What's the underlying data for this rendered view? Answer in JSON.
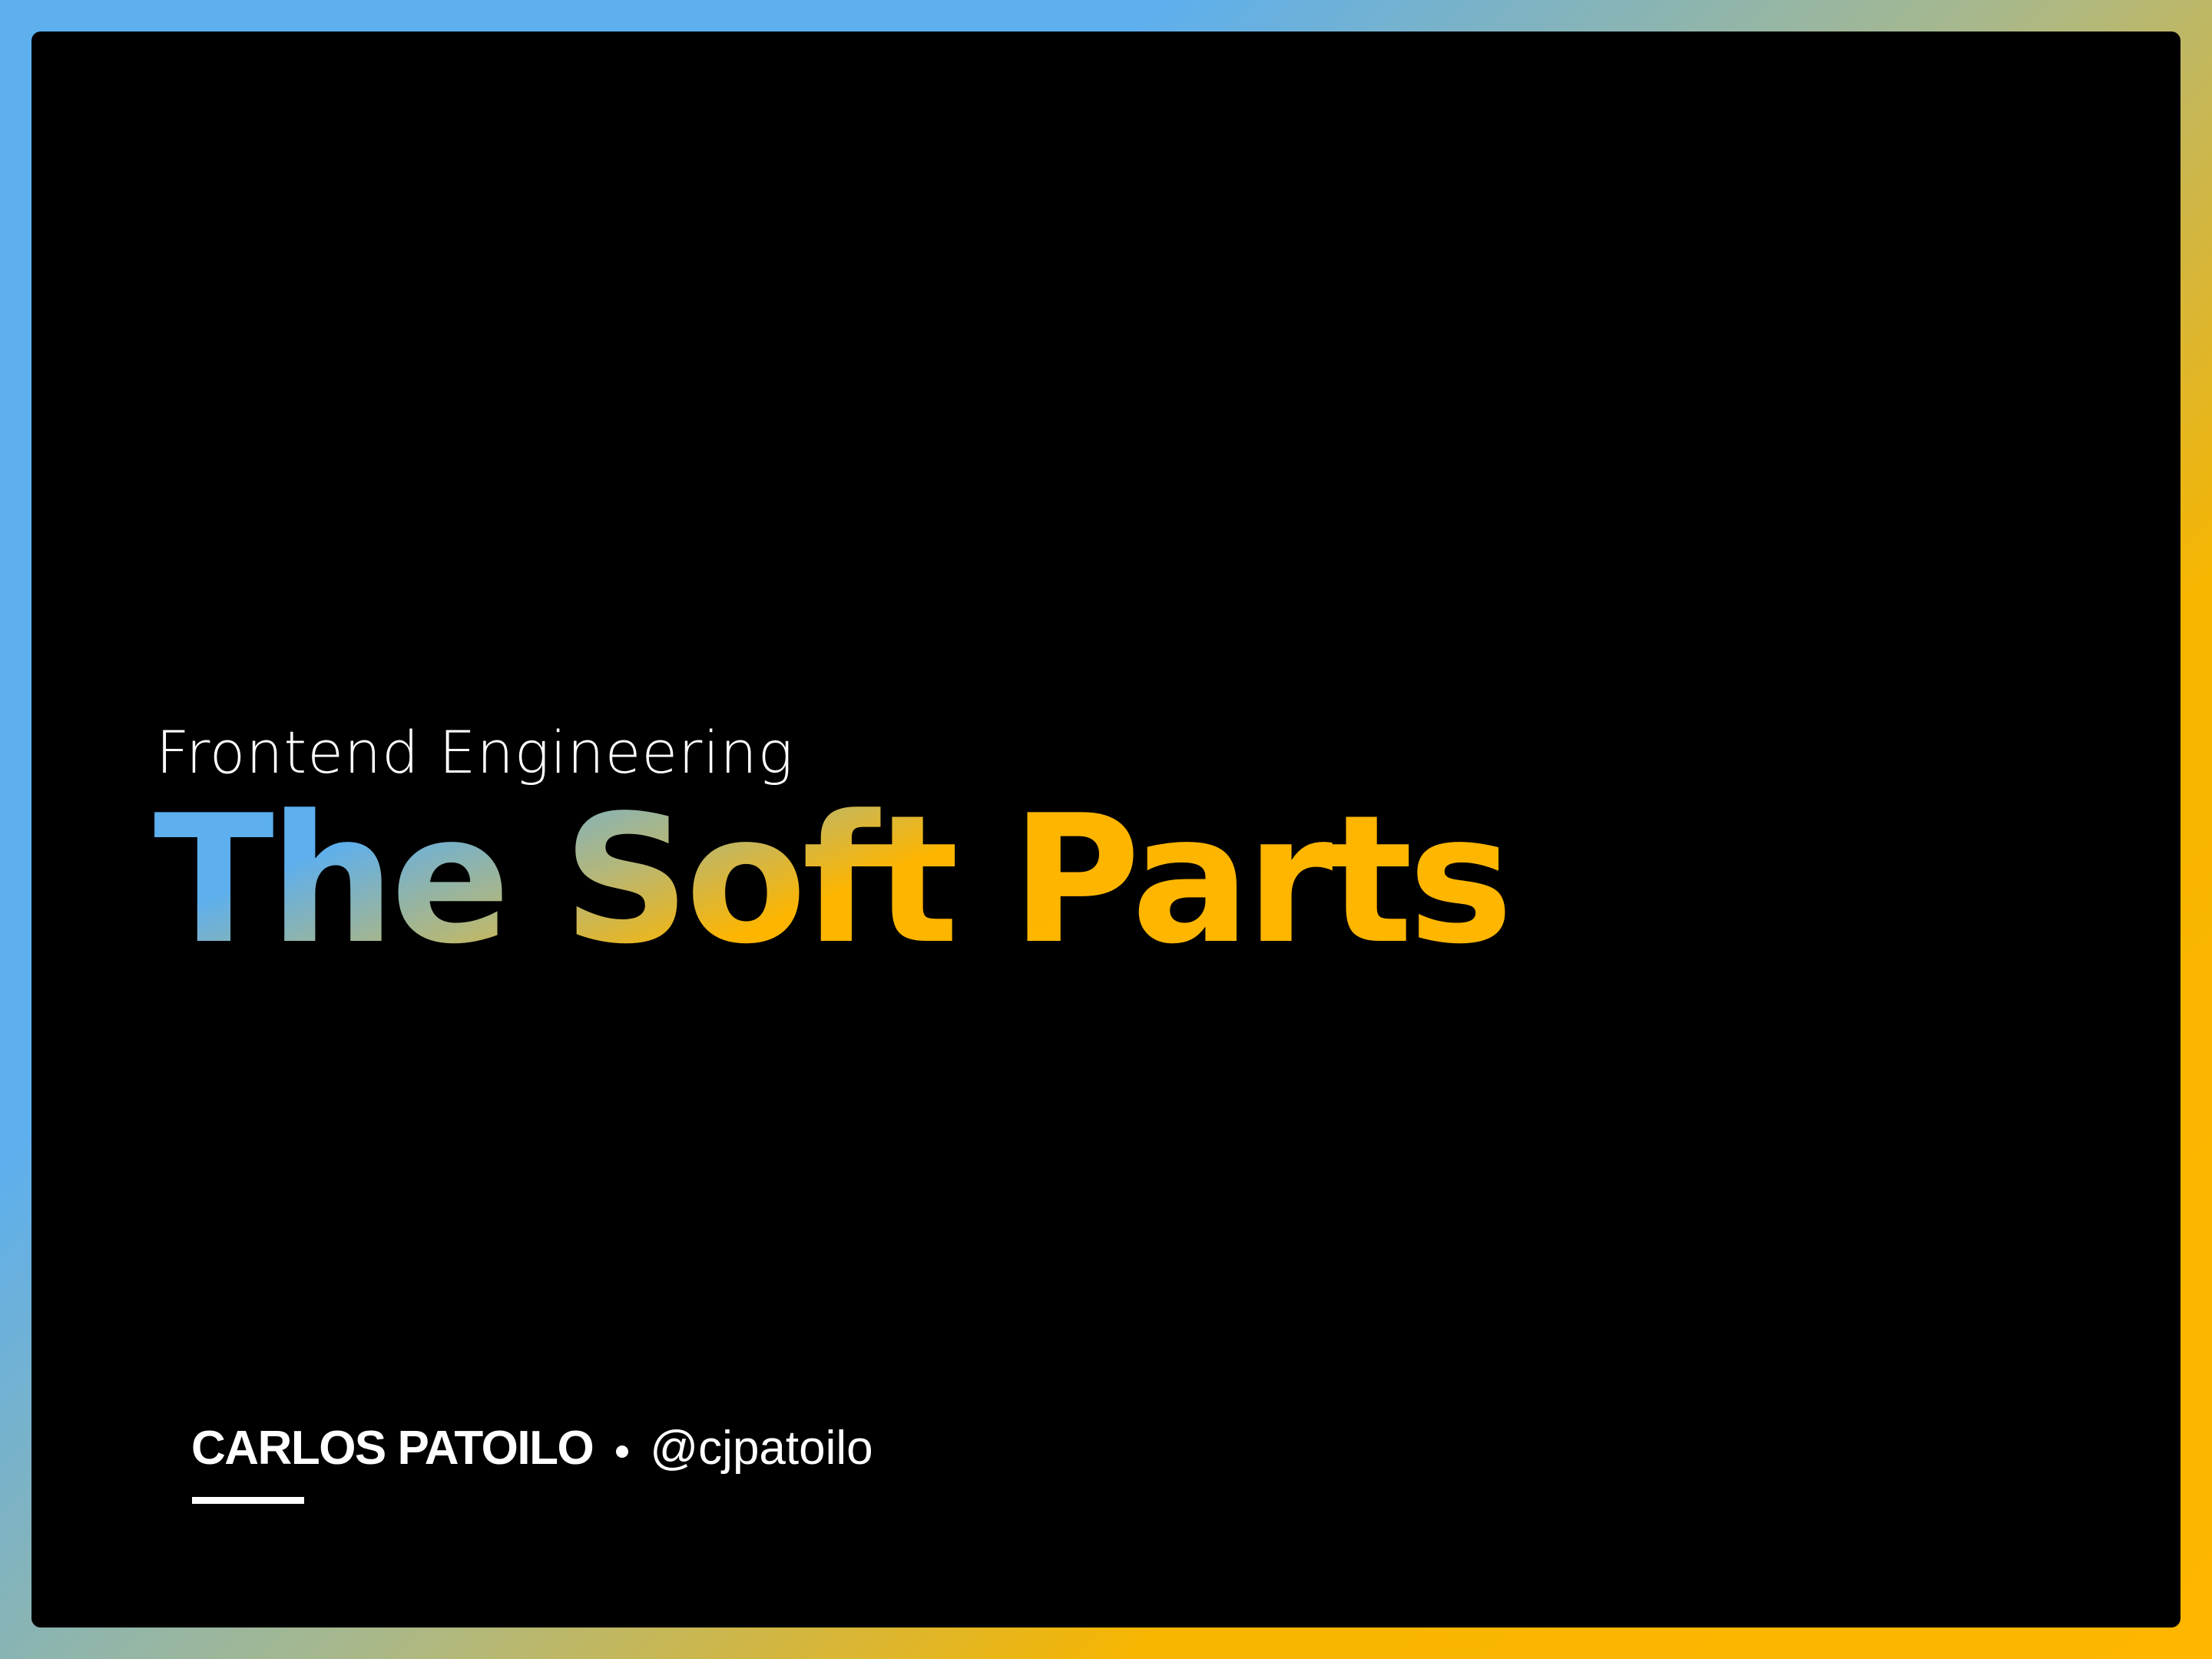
{
  "slide": {
    "subtitle": "Frontend Engineering",
    "title": "The Soft Parts",
    "author": {
      "name": "CARLOS PATOILO",
      "separator": "•",
      "handle": "@cjpatoilo"
    }
  },
  "colors": {
    "frame_gradient_start": "#5DAFEE",
    "frame_gradient_end": "#FEB600",
    "slide_background": "#000000",
    "text": "#FFFFFF",
    "title_gradient_start": "#5DAFEE",
    "title_gradient_end": "#FEB600"
  }
}
